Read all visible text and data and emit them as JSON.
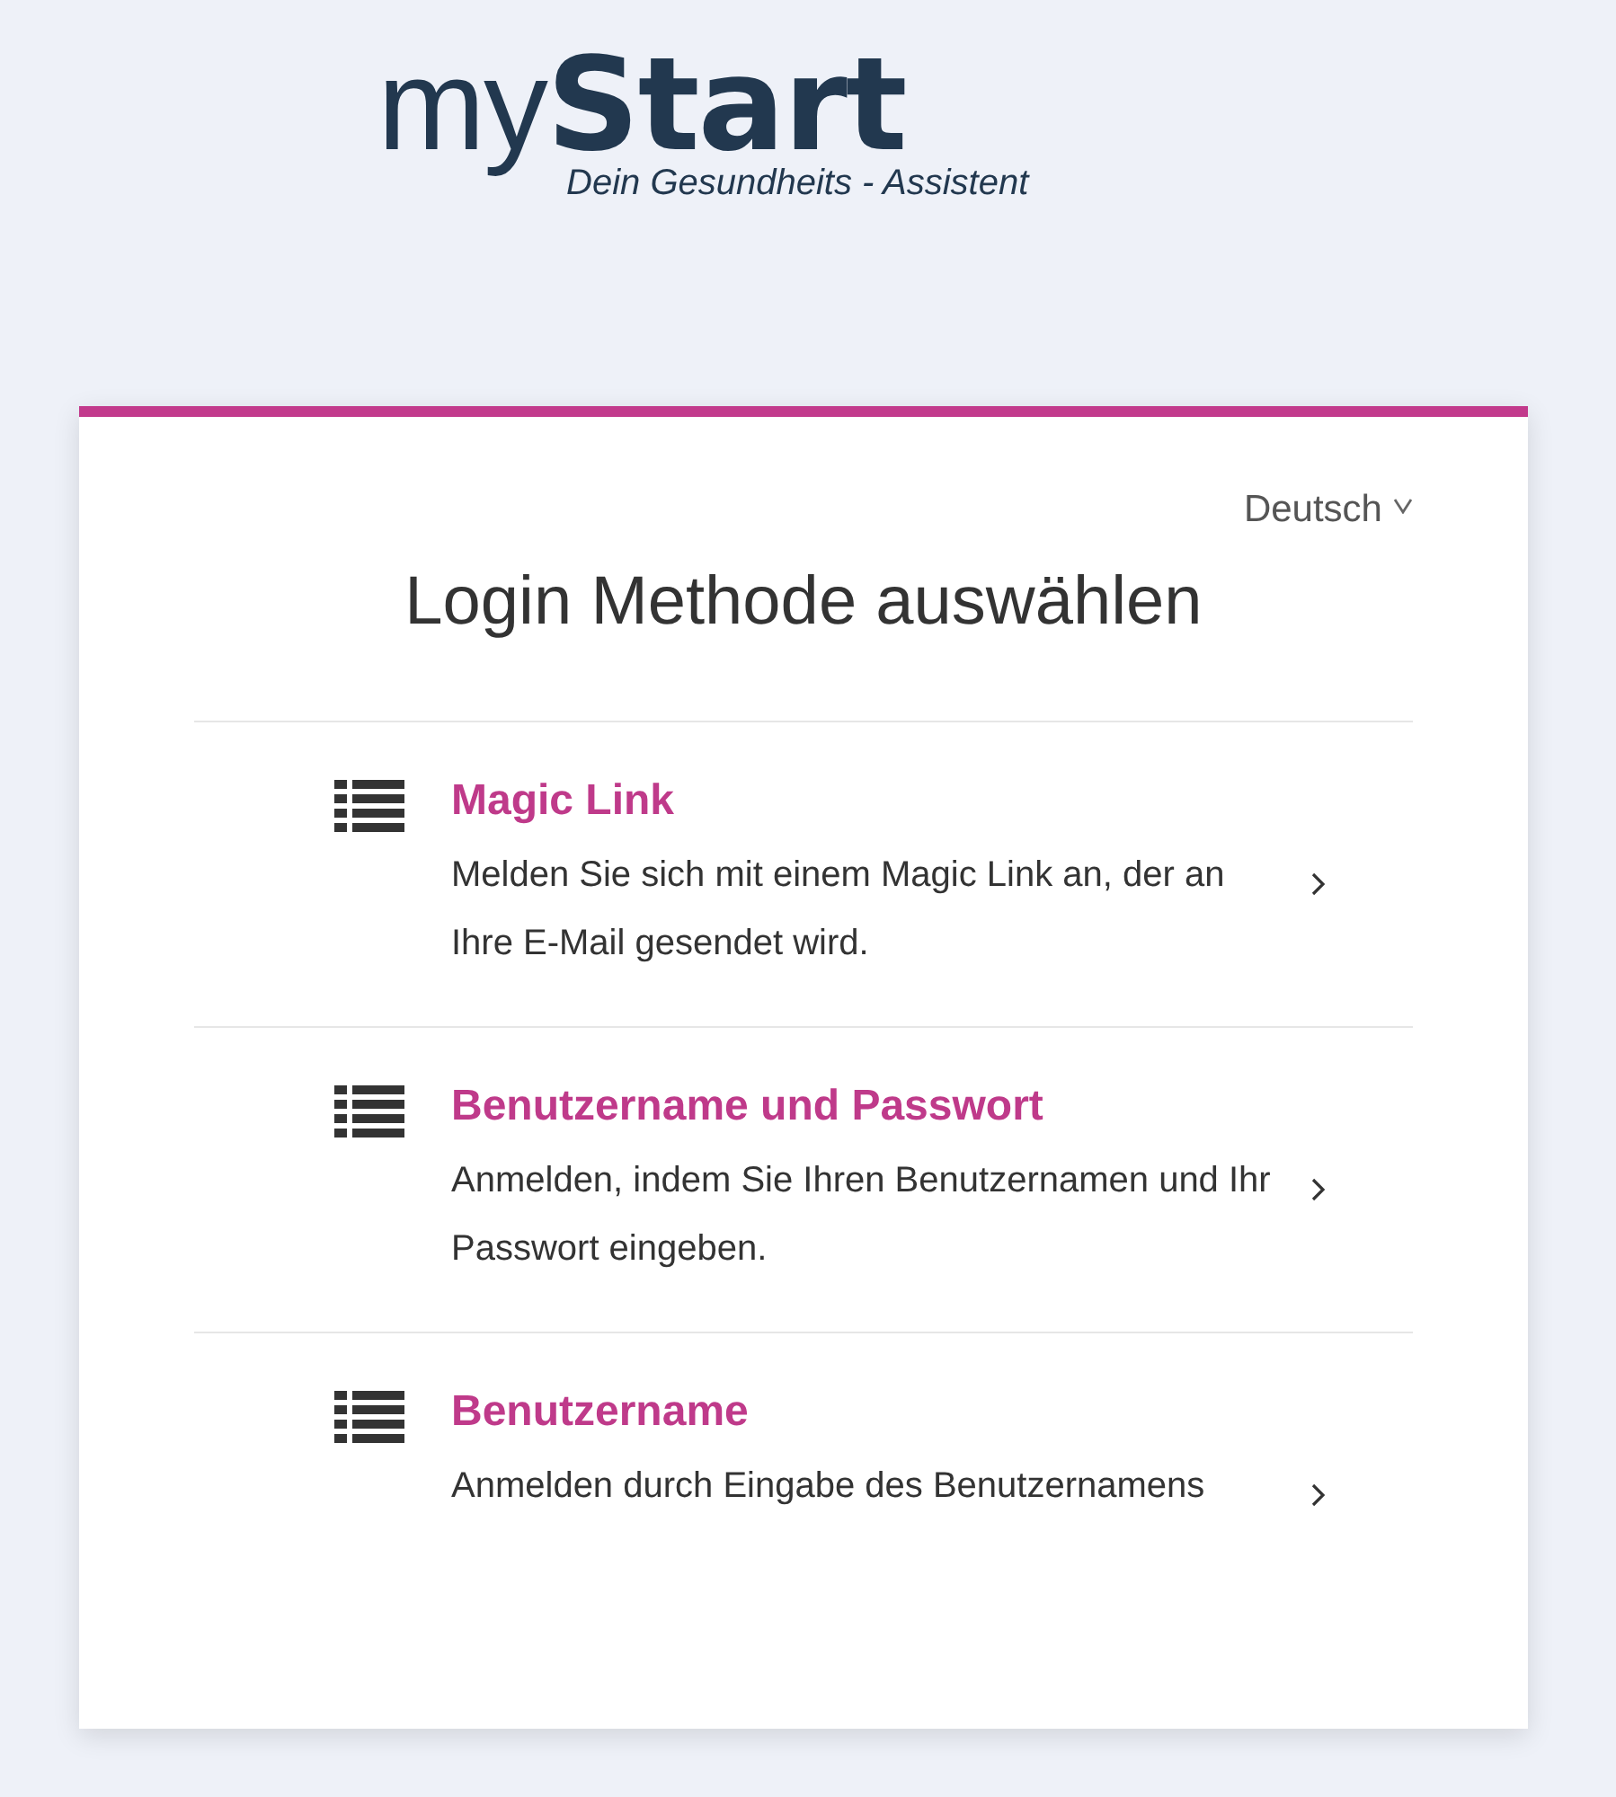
{
  "logo": {
    "light": "my",
    "bold": "Start",
    "tagline": "Dein Gesundheits - Assistent"
  },
  "language": "Deutsch",
  "title": "Login Methode auswählen",
  "methods": [
    {
      "name": "Magic Link",
      "description": "Melden Sie sich mit einem Magic Link an, der an Ihre E-Mail gesendet wird."
    },
    {
      "name": "Benutzername und Passwort",
      "description": "Anmelden, indem Sie Ihren Benutzernamen und Ihr Passwort eingeben."
    },
    {
      "name": "Benutzername",
      "description": "Anmelden durch Eingabe des Benutzernamens"
    }
  ]
}
